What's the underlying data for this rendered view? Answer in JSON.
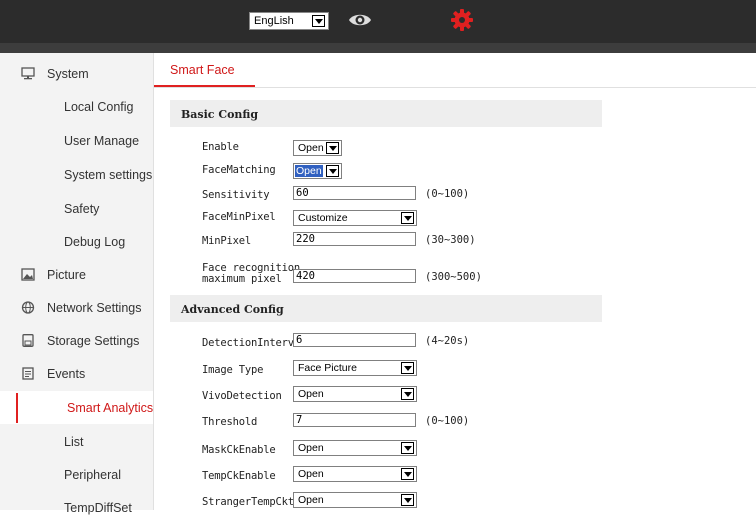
{
  "header": {
    "language_value": "EngLish",
    "icons": [
      "eye-icon",
      "gear-icon"
    ],
    "accent_color": "#e02020"
  },
  "sidebar": {
    "items": [
      {
        "label": "System",
        "icon": "monitor-icon"
      },
      {
        "label": "Local Config"
      },
      {
        "label": "User Manage"
      },
      {
        "label": "System settings"
      },
      {
        "label": "Safety"
      },
      {
        "label": "Debug Log"
      },
      {
        "label": "Picture",
        "icon": "image-icon"
      },
      {
        "label": "Network Settings",
        "icon": "globe-icon"
      },
      {
        "label": "Storage Settings",
        "icon": "storage-icon"
      },
      {
        "label": "Events",
        "icon": "calendar-icon"
      },
      {
        "label": "Smart Analytics",
        "active": true
      },
      {
        "label": "List"
      },
      {
        "label": "Peripheral"
      },
      {
        "label": "TempDiffSet"
      }
    ]
  },
  "main": {
    "tab": "Smart Face",
    "basic": {
      "title": "Basic Config",
      "enable_label": "Enable",
      "enable_value": "Open",
      "facematching_label": "FaceMatching",
      "facematching_value": "Open",
      "sensitivity_label": "Sensitivity",
      "sensitivity_value": "60",
      "sensitivity_range": "(0~100)",
      "faceminpixel_label": "FaceMinPixel",
      "faceminpixel_value": "Customize",
      "minpixel_label": "MinPixel",
      "minpixel_value": "220",
      "minpixel_range": "(30~300)",
      "maxpixel_label_line1": "Face recognition",
      "maxpixel_label_line2": "maximum pixel",
      "maxpixel_value": "420",
      "maxpixel_range": "(300~500)"
    },
    "advanced": {
      "title": "Advanced Config",
      "interval_label": "DetectionInterval",
      "interval_value": "6",
      "interval_range": "(4~20s)",
      "imagetype_label": "Image Type",
      "imagetype_value": "Face Picture",
      "vivo_label": "VivoDetection",
      "vivo_value": "Open",
      "threshold_label": "Threshold",
      "threshold_value": "7",
      "threshold_range": "(0~100)",
      "mask_label": "MaskCkEnable",
      "mask_value": "Open",
      "temp_label": "TempCkEnable",
      "temp_value": "Open",
      "stranger_label": "StrangerTempCkt",
      "stranger_value": "Open"
    }
  }
}
